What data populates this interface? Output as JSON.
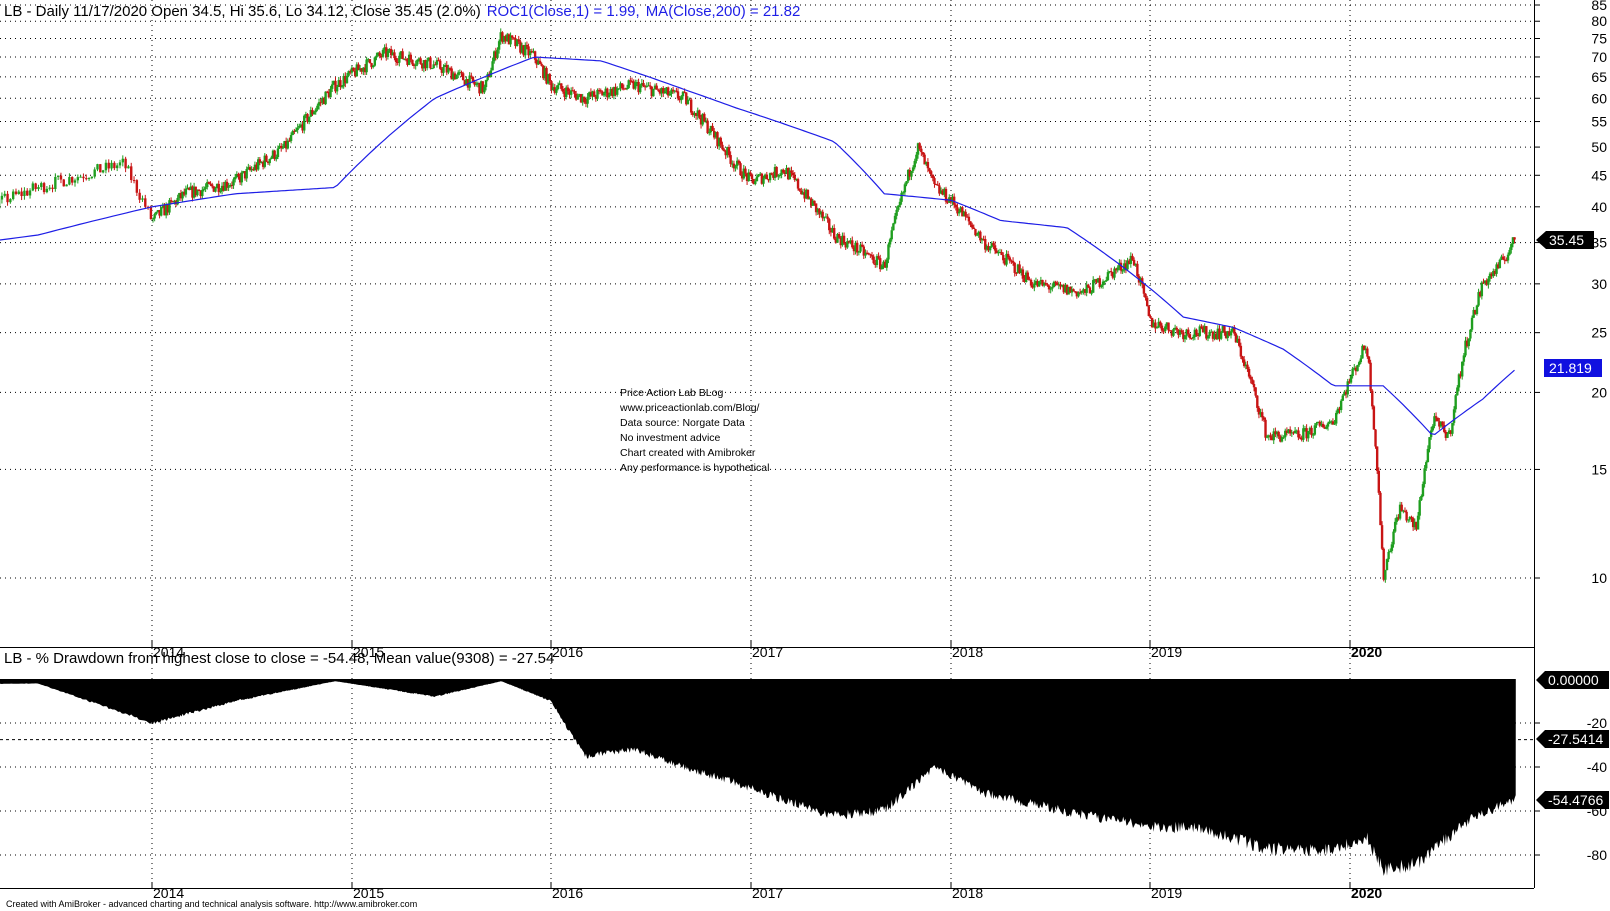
{
  "header": {
    "main": "LB - Daily 11/17/2020 Open 34.5, Hi 35.6, Lo 34.12, Close 35.45 (2.0%)",
    "roc": "ROC1(Close,1) = 1.99,",
    "ma": "MA(Close,200) = 21.82"
  },
  "lower_header": "LB - % Drawdown from highest close to close  = -54.48,   Mean value(9308) = -27.54",
  "notes": [
    "Price Action Lab BLog",
    "www.priceactionlab.com/Blog/",
    "Data source: Norgate Data",
    "No investment advice",
    "Chart created with Amibroker",
    "Any performance is hypothetical"
  ],
  "footer": "Created with AmiBroker - advanced charting and technical analysis software. http://www.amibroker.com",
  "tags": {
    "last_close": "35.45",
    "ma_value": "21.819",
    "dd_zero": "0.00000",
    "dd_mean": "-27.5414",
    "dd_last": "-54.4766"
  },
  "colors": {
    "up": "#1f9e1f",
    "down": "#c81414",
    "ma": "#1e1ee6",
    "area": "#000000",
    "ma_tag": "#1010e0"
  },
  "chart_data": [
    {
      "type": "candlestick",
      "title": "LB - Daily",
      "y_scale": "log",
      "y_ticks": [
        10,
        15,
        20,
        25,
        30,
        35,
        40,
        45,
        50,
        55,
        60,
        65,
        70,
        75,
        80,
        85
      ],
      "x_ticks": [
        "2014",
        "2015",
        "2016",
        "2017",
        "2018",
        "2019",
        "2020"
      ],
      "grid": true,
      "close_series": {
        "dates": [
          "2013-03",
          "2013-06",
          "2013-09",
          "2013-12",
          "2014-01",
          "2014-03",
          "2014-06",
          "2014-09",
          "2014-12",
          "2015-03",
          "2015-06",
          "2015-09",
          "2015-10",
          "2015-12",
          "2016-01",
          "2016-03",
          "2016-06",
          "2016-09",
          "2016-12",
          "2017-01",
          "2017-03",
          "2017-06",
          "2017-09",
          "2017-11",
          "2017-12",
          "2018-01",
          "2018-03",
          "2018-06",
          "2018-09",
          "2018-12",
          "2019-01",
          "2019-03",
          "2019-06",
          "2019-08",
          "2019-10",
          "2019-12",
          "2020-02",
          "2020-03",
          "2020-04",
          "2020-05",
          "2020-06",
          "2020-07",
          "2020-08",
          "2020-09",
          "2020-10",
          "2020-11"
        ],
        "close": [
          35,
          38,
          43,
          47,
          38,
          42,
          44,
          50,
          63,
          71,
          68,
          62,
          76,
          70,
          63,
          60,
          63,
          60,
          47,
          44,
          46,
          36,
          32,
          50,
          43,
          41,
          35,
          30,
          29,
          33,
          26,
          25,
          25,
          17,
          17,
          18,
          24,
          10,
          13,
          12,
          18,
          17,
          24,
          30,
          32,
          35.45
        ]
      },
      "ma_series": {
        "name": "MA(Close,200)",
        "dates": [
          "2013-03",
          "2013-09",
          "2014-01",
          "2014-06",
          "2014-12",
          "2015-06",
          "2015-12",
          "2016-04",
          "2016-09",
          "2016-12",
          "2017-06",
          "2017-09",
          "2018-01",
          "2018-04",
          "2018-08",
          "2018-12",
          "2019-03",
          "2019-06",
          "2019-09",
          "2019-12",
          "2020-03",
          "2020-06",
          "2020-09",
          "2020-11"
        ],
        "values": [
          33,
          36,
          40,
          42,
          43,
          60,
          70,
          69,
          62,
          58,
          51,
          42,
          41,
          38,
          37,
          31,
          26.5,
          25.5,
          23.5,
          20.5,
          20.5,
          17,
          19.5,
          21.82
        ]
      }
    },
    {
      "type": "area",
      "title": "% Drawdown from highest close to close",
      "y_ticks": [
        -80,
        -60,
        -40,
        -20
      ],
      "mean": -27.54,
      "last": -54.48,
      "dates": [
        "2013-03",
        "2013-09",
        "2014-01",
        "2014-06",
        "2014-12",
        "2015-06",
        "2015-10",
        "2016-01",
        "2016-03",
        "2016-06",
        "2016-09",
        "2016-12",
        "2017-03",
        "2017-06",
        "2017-09",
        "2017-12",
        "2018-03",
        "2018-09",
        "2019-01",
        "2019-04",
        "2019-08",
        "2019-12",
        "2020-02",
        "2020-03",
        "2020-05",
        "2020-08",
        "2020-11"
      ],
      "values": [
        -3,
        -2,
        -20,
        -10,
        -1,
        -8,
        -1,
        -10,
        -35,
        -32,
        -40,
        -47,
        -55,
        -62,
        -60,
        -40,
        -52,
        -62,
        -67,
        -68,
        -77,
        -78,
        -72,
        -87,
        -84,
        -65,
        -54.48
      ]
    }
  ]
}
